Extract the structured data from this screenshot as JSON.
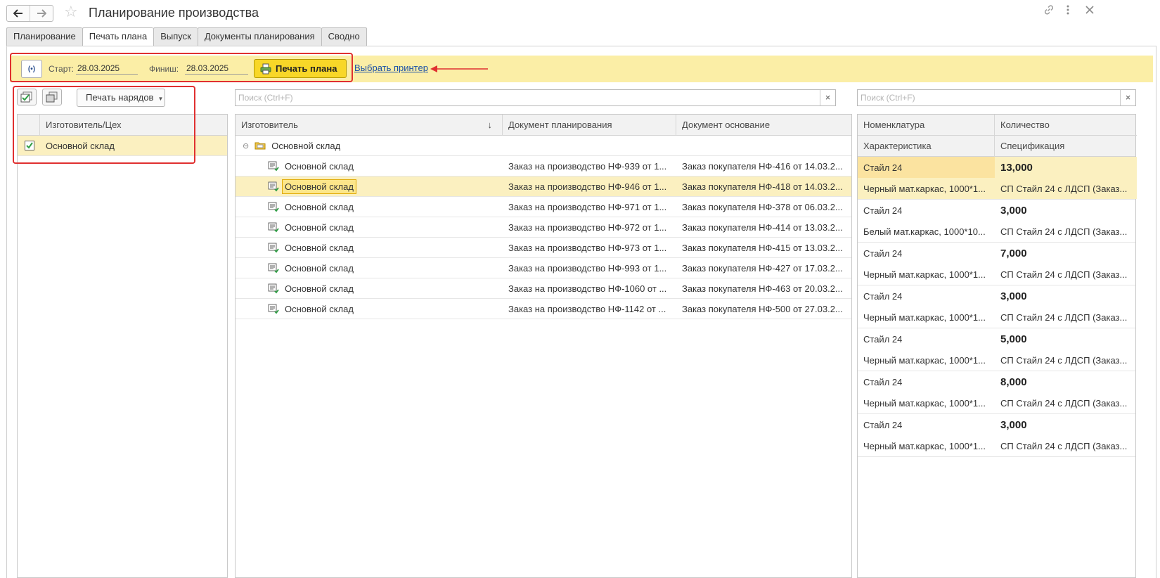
{
  "window": {
    "title": "Планирование производства"
  },
  "tabs": [
    {
      "label": "Планирование"
    },
    {
      "label": "Печать плана"
    },
    {
      "label": "Выпуск"
    },
    {
      "label": "Документы планирования"
    },
    {
      "label": "Сводно"
    }
  ],
  "active_tab": "Печать плана",
  "toolbar": {
    "start_label": "Старт:",
    "start_value": "28.03.2025",
    "finish_label": "Финиш:",
    "finish_value": "28.03.2025",
    "print_plan_label": "Печать плана",
    "select_printer_link": "Выбрать принтер"
  },
  "left_pane": {
    "print_orders_label": "Печать нарядов",
    "column_header": "Изготовитель/Цех",
    "rows": [
      {
        "label": "Основной склад",
        "checked": true
      }
    ]
  },
  "middle_pane": {
    "search_placeholder": "Поиск (Ctrl+F)",
    "columns": [
      "Изготовитель",
      "Документ планирования",
      "Документ основание"
    ],
    "sort_indicator": "↓",
    "group_label": "Основной склад",
    "rows": [
      {
        "maker": "Основной склад",
        "plan_doc": "Заказ на производство НФ-939 от 1...",
        "base_doc": "Заказ покупателя НФ-416 от 14.03.2..."
      },
      {
        "maker": "Основной склад",
        "plan_doc": "Заказ на производство НФ-946 от 1...",
        "base_doc": "Заказ покупателя НФ-418 от 14.03.2..."
      },
      {
        "maker": "Основной склад",
        "plan_doc": "Заказ на производство НФ-971 от 1...",
        "base_doc": "Заказ покупателя НФ-378 от 06.03.2..."
      },
      {
        "maker": "Основной склад",
        "plan_doc": "Заказ на производство НФ-972 от 1...",
        "base_doc": "Заказ покупателя НФ-414 от 13.03.2..."
      },
      {
        "maker": "Основной склад",
        "plan_doc": "Заказ на производство НФ-973 от 1...",
        "base_doc": "Заказ покупателя НФ-415 от 13.03.2..."
      },
      {
        "maker": "Основной склад",
        "plan_doc": "Заказ на производство НФ-993 от 1...",
        "base_doc": "Заказ покупателя НФ-427 от 17.03.2..."
      },
      {
        "maker": "Основной склад",
        "plan_doc": "Заказ на производство НФ-1060 от ...",
        "base_doc": "Заказ покупателя НФ-463 от 20.03.2..."
      },
      {
        "maker": "Основной склад",
        "plan_doc": "Заказ на производство НФ-1142 от ...",
        "base_doc": "Заказ покупателя НФ-500 от 27.03.2..."
      }
    ],
    "selected_row": 1
  },
  "right_pane": {
    "search_placeholder": "Поиск (Ctrl+F)",
    "columns_top": [
      "Номенклатура",
      "Количество"
    ],
    "columns_bottom": [
      "Характеристика",
      "Спецификация"
    ],
    "rows": [
      {
        "item": "Стайл 24",
        "qty": "13,000",
        "characteristic": "Черный мат.каркас, 1000*1...",
        "spec": "СП Стайл 24 с ЛДСП (Заказ..."
      },
      {
        "item": "Стайл 24",
        "qty": "3,000",
        "characteristic": "Белый мат.каркас, 1000*10...",
        "spec": "СП Стайл 24 с ЛДСП (Заказ..."
      },
      {
        "item": "Стайл 24",
        "qty": "7,000",
        "characteristic": "Черный мат.каркас, 1000*1...",
        "spec": "СП Стайл 24 с ЛДСП (Заказ..."
      },
      {
        "item": "Стайл 24",
        "qty": "3,000",
        "characteristic": "Черный мат.каркас, 1000*1...",
        "spec": "СП Стайл 24 с ЛДСП (Заказ..."
      },
      {
        "item": "Стайл 24",
        "qty": "5,000",
        "characteristic": "Черный мат.каркас, 1000*1...",
        "spec": "СП Стайл 24 с ЛДСП (Заказ..."
      },
      {
        "item": "Стайл 24",
        "qty": "8,000",
        "characteristic": "Черный мат.каркас, 1000*1...",
        "spec": "СП Стайл 24 с ЛДСП (Заказ..."
      },
      {
        "item": "Стайл 24",
        "qty": "3,000",
        "characteristic": "Черный мат.каркас, 1000*1...",
        "spec": "СП Стайл 24 с ЛДСП (Заказ..."
      }
    ],
    "selected_row": 0
  },
  "colors": {
    "toolbar_bg": "#fbeea6",
    "print_button": "#f8d728",
    "selected_row": "#fbf0c0",
    "annotation_red": "#e03030",
    "link": "#1a4fa6"
  }
}
